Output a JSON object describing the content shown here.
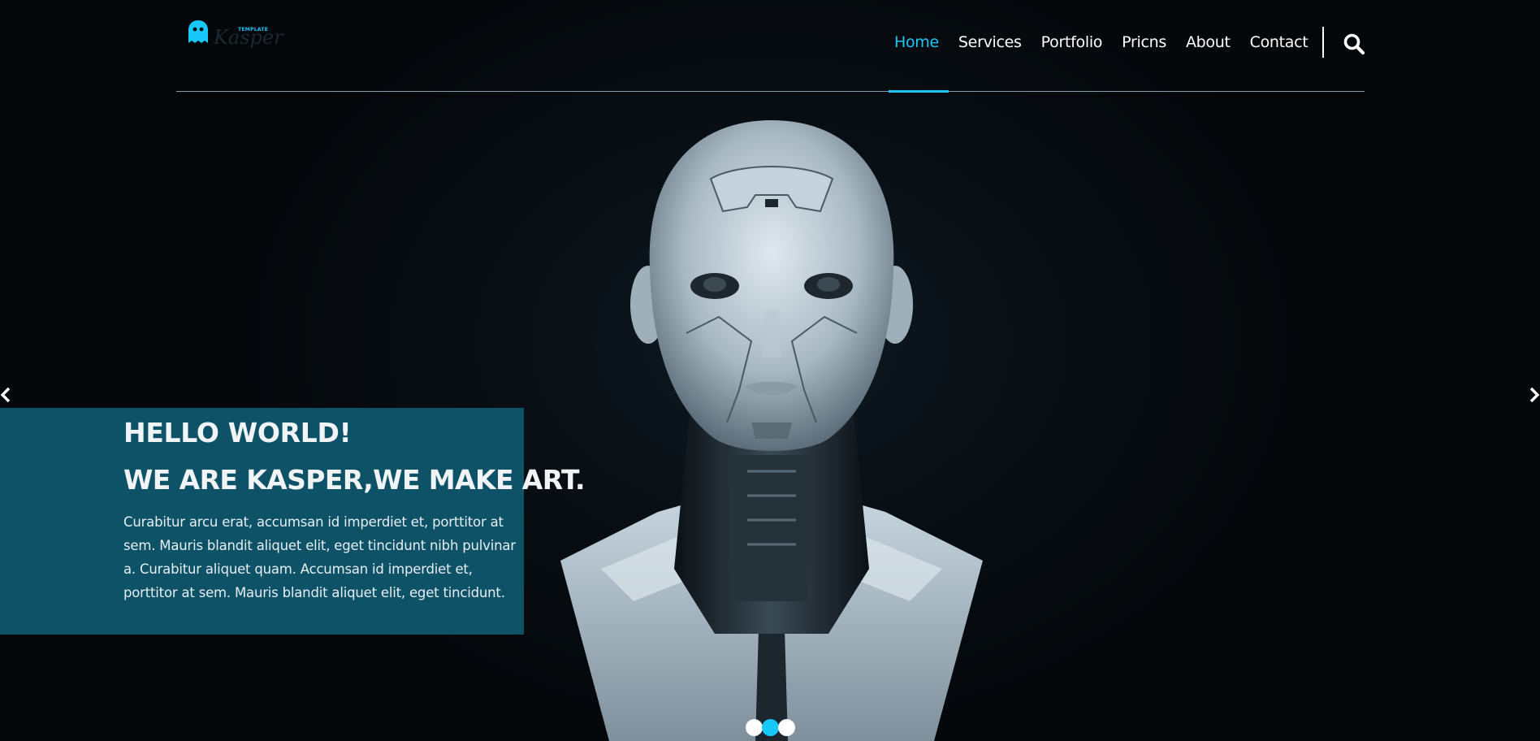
{
  "brand": {
    "small_label": "TEMPLATE",
    "name": "Kasper",
    "accent_color": "#19c8fa",
    "logo_icon": "ghost-icon"
  },
  "nav": {
    "items": [
      {
        "label": "Home",
        "active": true
      },
      {
        "label": "Services",
        "active": false
      },
      {
        "label": "Portfolio",
        "active": false
      },
      {
        "label": "Pricns",
        "active": false
      },
      {
        "label": "About",
        "active": false
      },
      {
        "label": "Contact",
        "active": false
      }
    ],
    "search_icon": "search-icon"
  },
  "hero": {
    "title_line1": "HELLO WORLD!",
    "title_line2": "WE ARE KASPER,WE MAKE ART.",
    "text": "Curabitur arcu erat, accumsan id imperdiet et, porttitor at sem. Mauris blandit aliquet elit, eget tincidunt nibh pulvinar a. Curabitur aliquet quam. Accumsan id imperdiet et, porttitor at sem. Mauris blandit aliquet elit, eget tincidunt.",
    "caption_bg": "#0d5266"
  },
  "carousel": {
    "prev_icon": "chevron-left-icon",
    "next_icon": "chevron-right-icon",
    "slide_count": 3,
    "active_slide": 2
  }
}
